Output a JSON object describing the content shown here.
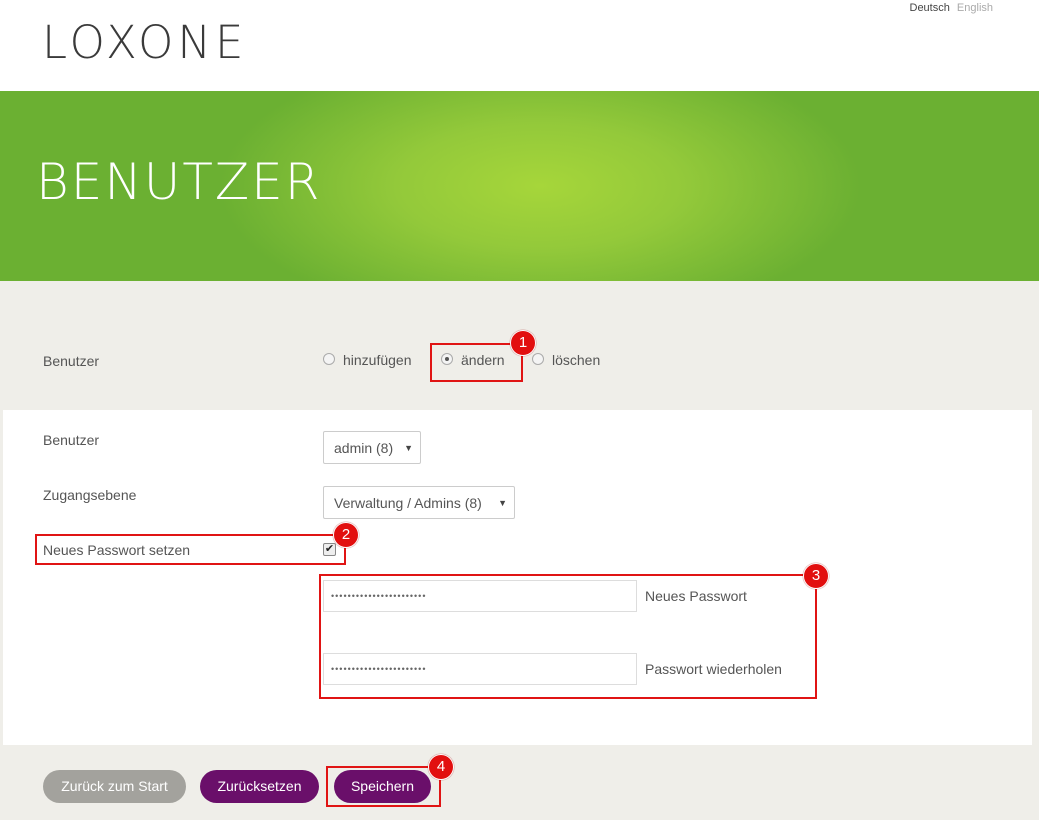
{
  "header": {
    "logo": "LOXONE",
    "languages": {
      "de": "Deutsch",
      "en": "English"
    }
  },
  "banner": {
    "title": "BENUTZER"
  },
  "mode": {
    "label": "Benutzer",
    "options": [
      {
        "label": "hinzufügen",
        "selected": false
      },
      {
        "label": "ändern",
        "selected": true
      },
      {
        "label": "löschen",
        "selected": false
      }
    ]
  },
  "form": {
    "user": {
      "label": "Benutzer",
      "value": "admin (8)"
    },
    "access_level": {
      "label": "Zugangsebene",
      "value": "Verwaltung / Admins (8)"
    },
    "set_password": {
      "label": "Neues Passwort setzen",
      "checked": true
    },
    "new_password": {
      "label": "Neues Passwort",
      "value": "•••••••••••••••••••••••"
    },
    "repeat_password": {
      "label": "Passwort wiederholen",
      "value": "•••••••••••••••••••••••"
    }
  },
  "buttons": {
    "back": "Zurück zum Start",
    "reset": "Zurücksetzen",
    "save": "Speichern"
  },
  "annotations": {
    "badge_1": "1",
    "badge_2": "2",
    "badge_3": "3",
    "badge_4": "4",
    "color": "#e01414"
  },
  "colors": {
    "banner_green": "#8cc63f",
    "button_purple": "#6a0f6a",
    "button_grey": "#a3a29d",
    "background": "#efeee9"
  }
}
